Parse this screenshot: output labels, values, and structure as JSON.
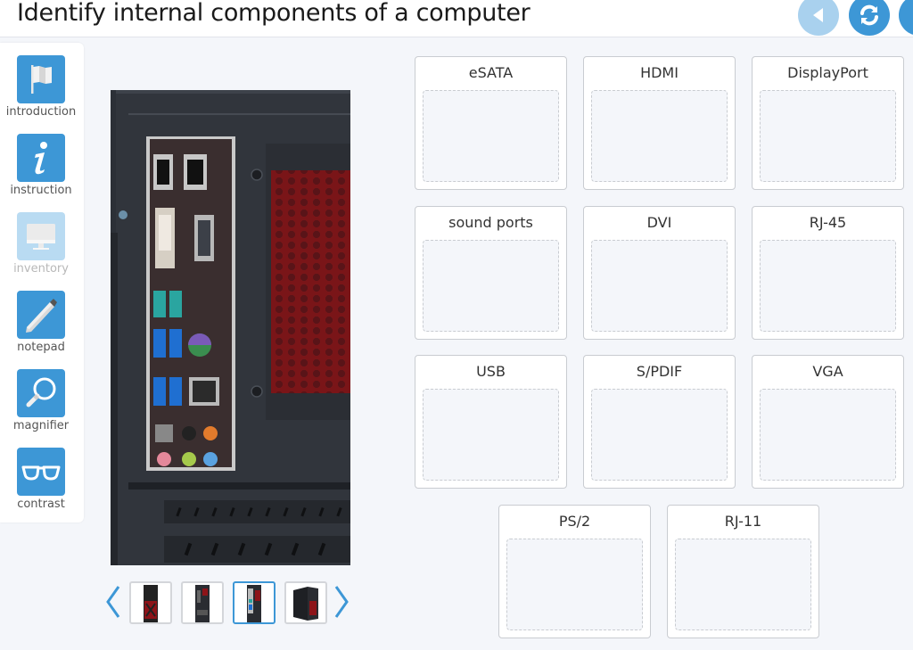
{
  "header": {
    "title": "Identify internal components of a computer",
    "buttons": [
      {
        "name": "back",
        "icon": "back-arrow-icon",
        "state": "disabled"
      },
      {
        "name": "reset",
        "icon": "refresh-icon",
        "state": "enabled"
      },
      {
        "name": "more",
        "icon": "info-icon",
        "state": "enabled"
      }
    ]
  },
  "sidebar": {
    "items": [
      {
        "label": "introduction",
        "icon": "flag-icon",
        "enabled": true
      },
      {
        "label": "instruction",
        "icon": "info-icon",
        "enabled": true
      },
      {
        "label": "inventory",
        "icon": "monitor-icon",
        "enabled": false
      },
      {
        "label": "notepad",
        "icon": "pencil-icon",
        "enabled": true
      },
      {
        "label": "magnifier",
        "icon": "magnifier-icon",
        "enabled": true
      },
      {
        "label": "contrast",
        "icon": "glasses-icon",
        "enabled": true
      }
    ]
  },
  "viewer": {
    "main_image": "computer-rear-io-panel",
    "thumbnails": [
      {
        "name": "computer-front",
        "active": false
      },
      {
        "name": "computer-rear",
        "active": false
      },
      {
        "name": "computer-rear-io-panel",
        "active": true
      },
      {
        "name": "computer-side",
        "active": false
      }
    ],
    "prev_icon": "chevron-left-icon",
    "next_icon": "chevron-right-icon"
  },
  "targets": [
    {
      "label": "eSATA"
    },
    {
      "label": "HDMI"
    },
    {
      "label": "DisplayPort"
    },
    {
      "label": "sound ports"
    },
    {
      "label": "DVI"
    },
    {
      "label": "RJ-45"
    },
    {
      "label": "USB"
    },
    {
      "label": "S/PDIF"
    },
    {
      "label": "VGA"
    },
    {
      "label": "PS/2"
    },
    {
      "label": "RJ-11"
    }
  ],
  "colors": {
    "accent": "#3d97d6",
    "accent_disabled": "#b9dbf2",
    "background": "#f4f6fa"
  }
}
